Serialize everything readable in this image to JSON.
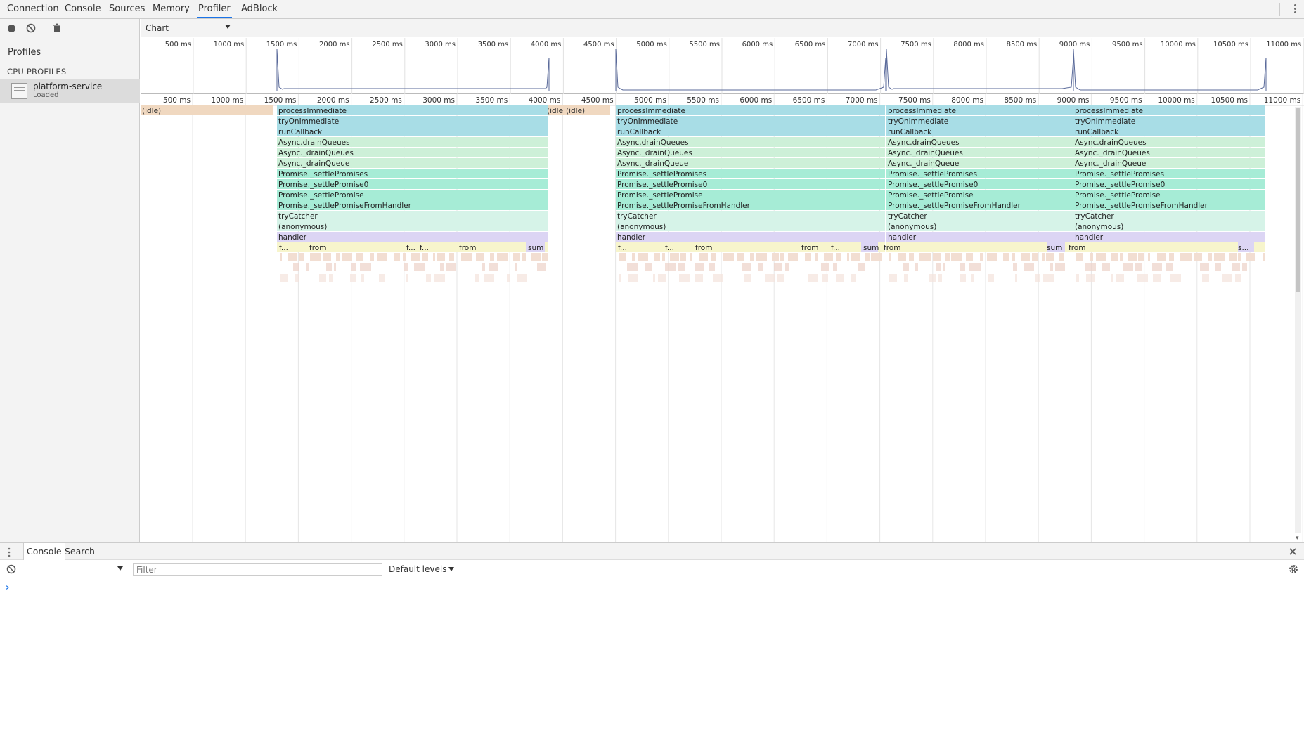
{
  "top_tabs": [
    "Connection",
    "Console",
    "Sources",
    "Memory",
    "Profiler",
    "AdBlock"
  ],
  "selected_tab": "Profiler",
  "sidebar": {
    "title": "Profiles",
    "section": "CPU PROFILES",
    "profile_name": "platform-service",
    "profile_status": "Loaded"
  },
  "chart_toolbar": {
    "view": "Chart"
  },
  "overview_ticks": [
    "500 ms",
    "1000 ms",
    "1500 ms",
    "2000 ms",
    "2500 ms",
    "3000 ms",
    "3500 ms",
    "4000 ms",
    "4500 ms",
    "5000 ms",
    "5500 ms",
    "6000 ms",
    "6500 ms",
    "7000 ms",
    "7500 ms",
    "8000 ms",
    "8500 ms",
    "9000 ms",
    "9500 ms",
    "10000 ms",
    "10500 ms",
    "11000 ms"
  ],
  "flame_ticks": [
    "500 ms",
    "1000 ms",
    "1500 ms",
    "2000 ms",
    "2500 ms",
    "3000 ms",
    "3500 ms",
    "4000 ms",
    "4500 ms",
    "5000 ms",
    "5500 ms",
    "6000 ms",
    "6500 ms",
    "7000 ms",
    "7500 ms",
    "8000 ms",
    "8500 ms",
    "9000 ms",
    "9500 ms",
    "10000 ms",
    "10500 ms",
    "11000 ms"
  ],
  "idle_labels": [
    "(idle)",
    "(idle)",
    "(idle)"
  ],
  "stack": [
    "processImmediate",
    "tryOnImmediate",
    "runCallback",
    "Async.drainQueues",
    "Async._drainQueues",
    "Async._drainQueue",
    "Promise._settlePromises",
    "Promise._settlePromise0",
    "Promise._settlePromise",
    "Promise._settlePromiseFromHandler",
    "tryCatcher",
    "(anonymous)",
    "handler"
  ],
  "leaf_labels": {
    "block1": [
      "f...",
      "from",
      "f...",
      "f...",
      "from",
      "sum"
    ],
    "block2": [
      "f...",
      "f...",
      "from",
      "from",
      "f...",
      "sum"
    ],
    "block3": [
      "from",
      "sum"
    ],
    "block4": [
      "from",
      "s..."
    ]
  },
  "drawer": {
    "tabs": [
      "Console",
      "Search"
    ],
    "selected_tab": "Console",
    "filter_placeholder": "Filter",
    "levels": "Default levels",
    "prompt": "›"
  },
  "colors": {
    "idle": "#f0d8c0",
    "immediate": "#a8dde6",
    "async": "#cdf0d8",
    "promise": "#a6ecd6",
    "trycatch": "#d6f3e8",
    "handler": "#dcd5f4",
    "leaf": "#f7f5cc",
    "accent": "#1a73e8"
  }
}
